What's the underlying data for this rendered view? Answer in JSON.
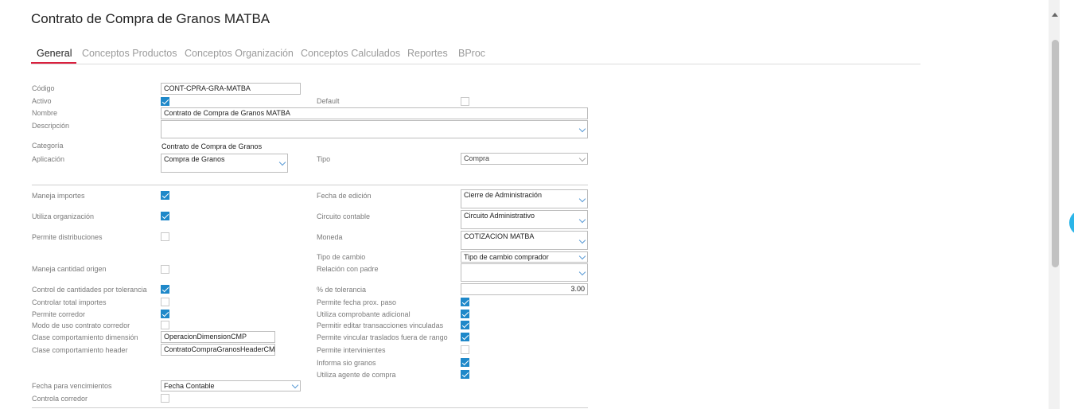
{
  "page_title": "Contrato de Compra de Granos MATBA",
  "tabs": [
    "General",
    "Conceptos Productos",
    "Conceptos Organización",
    "Conceptos Calculados",
    "Reportes",
    "BProc"
  ],
  "form": {
    "codigo": {
      "label": "Código",
      "value": "CONT-CPRA-GRA-MATBA"
    },
    "activo": {
      "label": "Activo",
      "checked": true
    },
    "default": {
      "label": "Default",
      "checked": false
    },
    "nombre": {
      "label": "Nombre",
      "value": "Contrato de Compra de Granos MATBA"
    },
    "descripcion": {
      "label": "Descripción",
      "value": ""
    },
    "categoria": {
      "label": "Categoría",
      "value": "Contrato de Compra de Granos"
    },
    "aplicacion": {
      "label": "Aplicación",
      "value": "Compra de Granos"
    },
    "tipo": {
      "label": "Tipo",
      "value": "Compra"
    },
    "maneja_importes": {
      "label": "Maneja importes",
      "checked": true
    },
    "fecha_edicion": {
      "label": "Fecha de edición",
      "value": "Cierre de Administración"
    },
    "utiliza_organizacion": {
      "label": "Utiliza organización",
      "checked": true
    },
    "circuito_contable": {
      "label": "Circuito contable",
      "value": "Circuito Administrativo"
    },
    "permite_distribuciones": {
      "label": "Permite distribuciones",
      "checked": false
    },
    "moneda": {
      "label": "Moneda",
      "value": "COTIZACION MATBA"
    },
    "tipo_cambio": {
      "label": "Tipo de cambio",
      "value": "Tipo de cambio comprador"
    },
    "maneja_cantidad_origen": {
      "label": "Maneja cantidad origen",
      "checked": false
    },
    "relacion_padre": {
      "label": "Relación con padre",
      "value": ""
    },
    "control_cantidades": {
      "label": "Control de cantidades por tolerancia",
      "checked": true
    },
    "pct_tolerancia": {
      "label": "% de tolerancia",
      "value": "3.00"
    },
    "controlar_total": {
      "label": "Controlar total importes",
      "checked": false
    },
    "permite_fecha_prox": {
      "label": "Permite fecha prox. paso",
      "checked": true
    },
    "permite_corredor": {
      "label": "Permite corredor",
      "checked": true
    },
    "utiliza_comprobante": {
      "label": "Utiliza comprobante adicional",
      "checked": true
    },
    "modo_uso_corredor": {
      "label": "Modo de uso contrato corredor",
      "checked": false
    },
    "permitir_editar": {
      "label": "Permitir editar transacciones vinculadas",
      "checked": true
    },
    "clase_dimension": {
      "label": "Clase comportamiento dimensión",
      "value": "OperacionDimensionCMP"
    },
    "permite_vincular": {
      "label": "Permite vincular traslados fuera de rango",
      "checked": true
    },
    "clase_header": {
      "label": "Clase comportamiento header",
      "value": "ContratoCompraGranosHeaderCMP"
    },
    "permite_intervinientes": {
      "label": "Permite intervinientes",
      "checked": false
    },
    "informa_sio": {
      "label": "Informa sio granos",
      "checked": true
    },
    "utiliza_agente": {
      "label": "Utiliza agente de compra",
      "checked": true
    },
    "fecha_vencimientos": {
      "label": "Fecha para vencimientos",
      "value": "Fecha Contable"
    },
    "controla_corredor": {
      "label": "Controla corredor",
      "checked": false
    }
  }
}
